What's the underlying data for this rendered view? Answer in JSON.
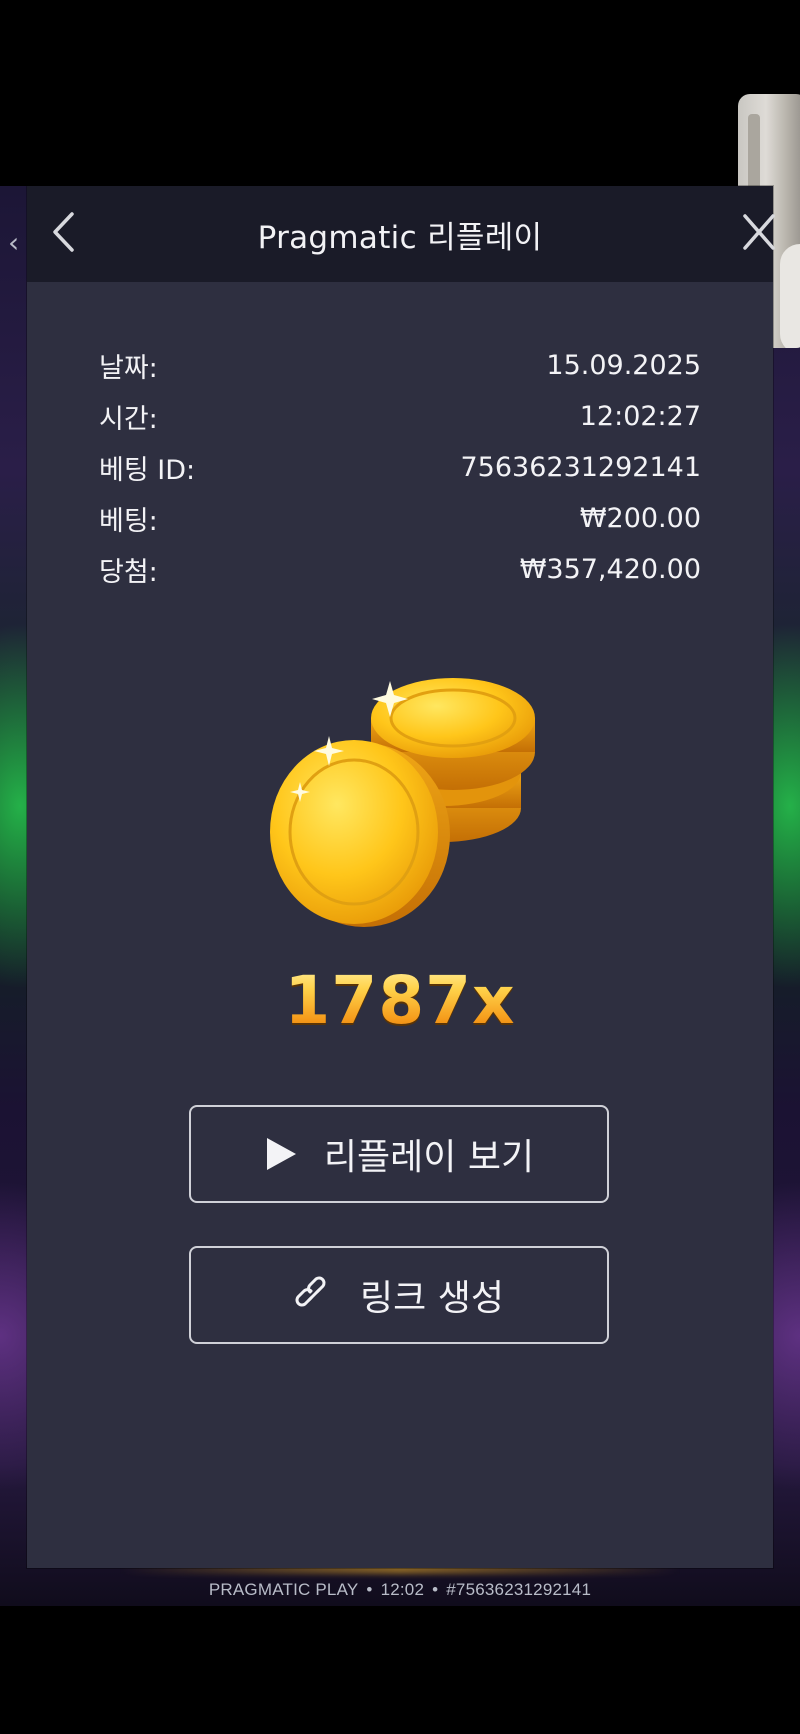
{
  "modal": {
    "title": "Pragmatic 리플레이",
    "rows": [
      {
        "label": "날짜:",
        "value": "15.09.2025"
      },
      {
        "label": "시간:",
        "value": "12:02:27"
      },
      {
        "label": "베팅 ID:",
        "value": "75636231292141"
      },
      {
        "label": "베팅:",
        "value": "₩200.00"
      },
      {
        "label": "당첨:",
        "value": "₩357,420.00"
      }
    ],
    "multiplier": "1787x",
    "buttons": {
      "replay": "리플레이 보기",
      "link": "링크 생성"
    }
  },
  "footer": {
    "brand": "PRAGMATIC PLAY",
    "time": "12:02",
    "bet_ref": "#75636231292141"
  },
  "icons": {
    "back": "chevron-left-icon",
    "close": "close-icon",
    "play": "play-icon",
    "link": "link-icon",
    "coins": "coin-stack-icon"
  },
  "colors": {
    "modal_bg": "#2e2f40",
    "header_bg": "#1a1b28",
    "multiplier_gold": "#f7b52a"
  }
}
